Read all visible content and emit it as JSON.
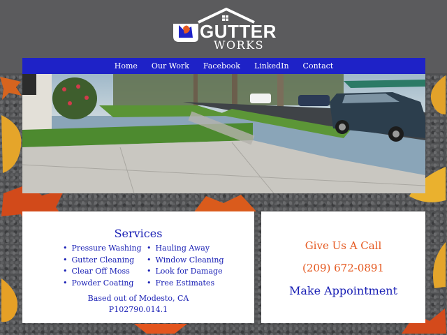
{
  "brand": {
    "name_main": "GUTTER",
    "name_sub": "WORKS",
    "colors": {
      "nav": "#1e22c7",
      "primary_text": "#1a20b5",
      "accent": "#e5581f"
    }
  },
  "nav": {
    "items": [
      {
        "label": "Home"
      },
      {
        "label": "Our Work"
      },
      {
        "label": "Facebook"
      },
      {
        "label": "LinkedIn"
      },
      {
        "label": "Contact"
      }
    ]
  },
  "services": {
    "title": "Services",
    "left_items": [
      "Pressure Washing",
      "Gutter Cleaning",
      "Clear Off Moss",
      "Powder Coating"
    ],
    "right_items": [
      "Hauling Away",
      "Window Cleaning",
      "Look for Damage",
      "Free Estimates"
    ],
    "based_out_of": "Based out of Modesto, CA",
    "license": "P102790.014.1"
  },
  "contact": {
    "give_call": "Give Us A Call",
    "phone": "(209) 672-0891",
    "appointment": "Make Appointment"
  }
}
